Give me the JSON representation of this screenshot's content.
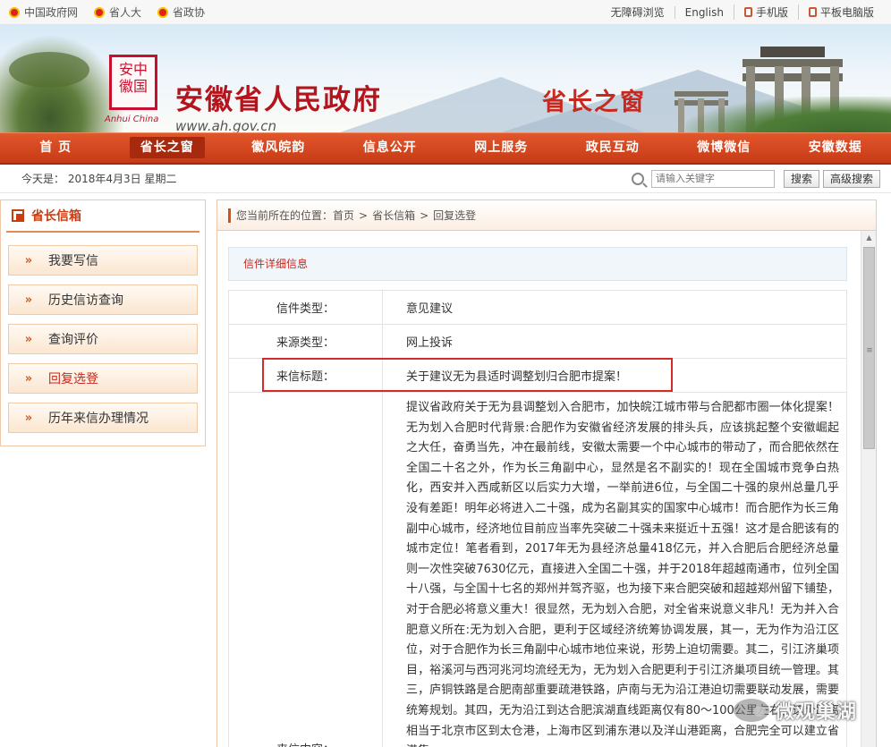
{
  "topbar": {
    "left_links": [
      "中国政府网",
      "省人大",
      "省政协"
    ],
    "right_links": [
      "无障碍浏览",
      "English",
      "手机版",
      "平板电脑版"
    ]
  },
  "banner": {
    "seal_chars": [
      "安",
      "中",
      "徽",
      "国"
    ],
    "seal_sub": "Anhui China",
    "title": "安徽省人民政府",
    "url": "www.ah.gov.cn",
    "section_title": "省长之窗"
  },
  "nav": {
    "items": [
      "首 页",
      "省长之窗",
      "徽风皖韵",
      "信息公开",
      "网上服务",
      "政民互动",
      "微博微信",
      "安徽数据"
    ],
    "active_index": 1
  },
  "datebar": {
    "date_text": "今天是： 2018年4月3日 星期二",
    "search_placeholder": "请输入关键字",
    "search_button": "搜索",
    "advanced_button": "高级搜索"
  },
  "sidebar": {
    "title": "省长信箱",
    "items": [
      "我要写信",
      "历史信访查询",
      "查询评价",
      "回复选登",
      "历年来信办理情况"
    ],
    "active_index": 3
  },
  "breadcrumb": {
    "prefix": "您当前所在的位置：",
    "items": [
      "首页",
      "省长信箱",
      "回复选登"
    ],
    "separator": ">"
  },
  "detail": {
    "section_title": "信件详细信息",
    "rows": [
      {
        "key": "信件类型：",
        "value": "意见建议"
      },
      {
        "key": "来源类型：",
        "value": "网上投诉"
      },
      {
        "key": "来信标题：",
        "value": "关于建议无为县适时调整划归合肥市提案！"
      }
    ],
    "content_key": "来信内容：",
    "content_text": "提议省政府关于无为县调整划入合肥市，加快皖江城市带与合肥都市圈一体化提案！无为划入合肥时代背景:合肥作为安徽省经济发展的排头兵，应该挑起整个安徽崛起之大任，奋勇当先，冲在最前线，安徽太需要一个中心城市的带动了，而合肥依然在全国二十名之外，作为长三角副中心，显然是名不副实的！现在全国城市竞争白热化，西安并入西咸新区以后实力大增，一举前进6位，与全国二十强的泉州总量几乎没有差距！明年必将进入二十强，成为名副其实的国家中心城市！而合肥作为长三角副中心城市，经济地位目前应当率先突破二十强未来挺近十五强！这才是合肥该有的城市定位！笔者看到，2017年无为县经济总量418亿元，并入合肥后合肥经济总量则一次性突破7630亿元，直接进入全国二十强，并于2018年超越南通市，位列全国十八强，与全国十七名的郑州并驾齐驱，也为接下来合肥突破和超越郑州留下铺垫，对于合肥必将意义重大！很显然，无为划入合肥，对全省来说意义非凡！无为并入合肥意义所在:无为划入合肥，更利于区域经济统筹协调发展，其一，无为作为沿江区位，对于合肥作为长三角副中心城市地位来说，形势上迫切需要。其二，引江济巢项目，裕溪河与西河兆河均流经无为，无为划入合肥更利于引江济巢项目统一管理。其三，庐铜铁路是合肥南部重要疏港铁路，庐南与无为沿江港迫切需要联动发展，需要统筹规划。其四，无为沿江到达合肥滨湖直线距离仅有80～100公里左右，这个距离相当于北京市区到太仓港，上海市区到浦东港以及洋山港距离，合肥完全可以建立省港集"
  },
  "watermark": "微观巢湖",
  "colors": {
    "accent": "#c8281e",
    "nav": "#d2491f",
    "highlight": "#d52a2a"
  }
}
